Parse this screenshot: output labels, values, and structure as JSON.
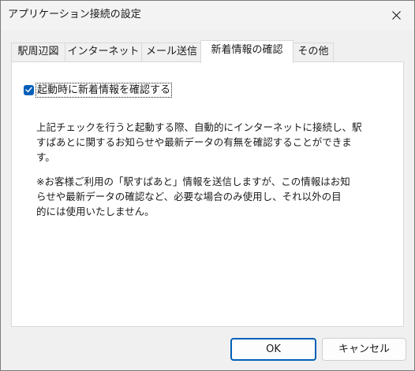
{
  "window": {
    "title": "アプリケーション接続の設定"
  },
  "tabs": [
    {
      "label": "駅周辺図"
    },
    {
      "label": "インターネット"
    },
    {
      "label": "メール送信"
    },
    {
      "label": "新着情報の確認",
      "selected": true
    },
    {
      "label": "その他"
    }
  ],
  "panel": {
    "checkbox": {
      "label": "起動時に新着情報を確認する",
      "checked": true
    },
    "description_1": "上記チェックを行うと起動する際、自動的にインターネットに接続し、駅\nすぱあとに関するお知らせや最新データの有無を確認することができま\nす。",
    "description_2": "※お客様ご利用の「駅すぱあと」情報を送信しますが、この情報はお知\nらせや最新データの確認など、必要な場合のみ使用し、それ以外の目\n的には使用いたしません。"
  },
  "buttons": {
    "ok": "OK",
    "cancel": "キャンセル"
  },
  "colors": {
    "accent": "#005fb8",
    "window_bg": "#f0f0f0",
    "panel_bg": "#ffffff"
  },
  "icons": {
    "close": "close-icon",
    "check": "check-icon"
  }
}
